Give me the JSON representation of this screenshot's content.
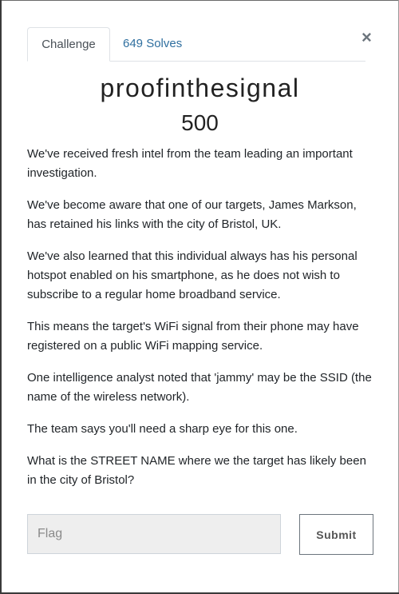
{
  "tabs": {
    "challenge": "Challenge",
    "solves": "649 Solves"
  },
  "close_label": "×",
  "challenge": {
    "name": "proofinthesignal",
    "value": "500",
    "description": [
      "We've received fresh intel from the team leading an important investigation.",
      "We've become aware that one of our targets, James Markson, has retained his links with the city of Bristol, UK.",
      "We've also learned that this individual always has his personal hotspot enabled on his smartphone, as he does not wish to subscribe to a regular home broadband service.",
      "This means the target's WiFi signal from their phone may have registered on a public WiFi mapping service.",
      "One intelligence analyst noted that 'jammy' may be the SSID (the name of the wireless network).",
      "The team says you'll need a sharp eye for this one.",
      "What is the STREET NAME where we the target has likely been in the city of Bristol?"
    ]
  },
  "form": {
    "flag_placeholder": "Flag",
    "flag_value": "",
    "submit_label": "Submit"
  }
}
